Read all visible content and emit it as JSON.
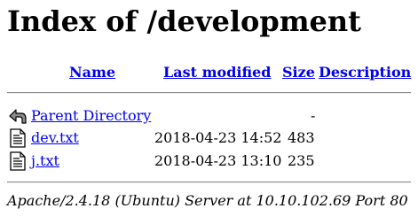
{
  "page": {
    "title": "Index of /development"
  },
  "table": {
    "headers": {
      "name": "Name",
      "last_modified": "Last modified",
      "size": "Size",
      "description": "Description"
    },
    "rows": [
      {
        "icon": "back-arrow-icon",
        "name": "Parent Directory",
        "last_modified": "",
        "size": "-",
        "description": ""
      },
      {
        "icon": "text-file-icon",
        "name": "dev.txt",
        "last_modified": "2018-04-23 14:52",
        "size": "483",
        "description": ""
      },
      {
        "icon": "text-file-icon",
        "name": "j.txt",
        "last_modified": "2018-04-23 13:10",
        "size": "235",
        "description": ""
      }
    ]
  },
  "footer": {
    "signature": "Apache/2.4.18 (Ubuntu) Server at 10.10.102.69 Port 80"
  },
  "colors": {
    "link": "#0000ee",
    "visited_link": "#551a8b",
    "text": "#000000",
    "background": "#ffffff"
  }
}
